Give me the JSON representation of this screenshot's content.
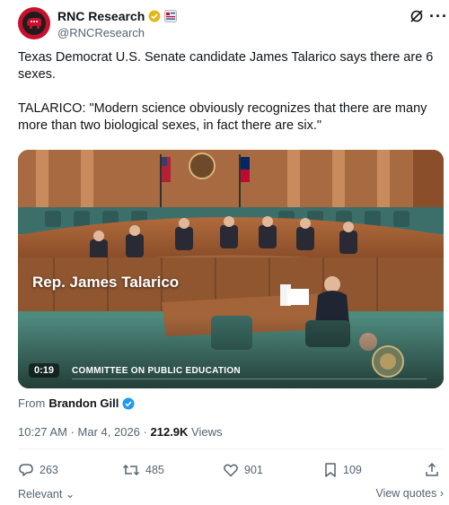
{
  "author": {
    "display_name": "RNC Research",
    "handle": "@RNCResearch",
    "avatar_icon": "republican-elephant-icon",
    "badges": [
      "gold-verified-badge-icon",
      "affiliate-badge-icon"
    ]
  },
  "toolbar": {
    "grok_icon": "grok-icon",
    "more_icon": "more-options-icon"
  },
  "tweet": {
    "paragraphs": [
      "Texas Democrat U.S. Senate candidate James Talarico says there are 6 sexes.",
      "TALARICO: \"Modern science obviously recognizes that there are many more than two biological sexes, in fact there are six.\""
    ]
  },
  "media": {
    "caption": "Rep. James Talarico",
    "duration": "0:19",
    "lower_third": "COMMITTEE ON PUBLIC EDUCATION"
  },
  "from": {
    "prefix": "From",
    "name": "Brandon Gill"
  },
  "meta": {
    "time": "10:27 AM",
    "separator": "·",
    "date": "Mar 4, 2026",
    "separator2": "·",
    "views_count": "212.9K",
    "views_label": "Views"
  },
  "actions": {
    "replies": "263",
    "reposts": "485",
    "likes": "901",
    "bookmarks": "109"
  },
  "footer": {
    "relevant_label": "Relevant",
    "view_quotes_label": "View quotes"
  },
  "colors": {
    "accent": "#1d9bf0",
    "gold": "#e2b719",
    "muted": "#536471",
    "text": "#0f1419"
  }
}
